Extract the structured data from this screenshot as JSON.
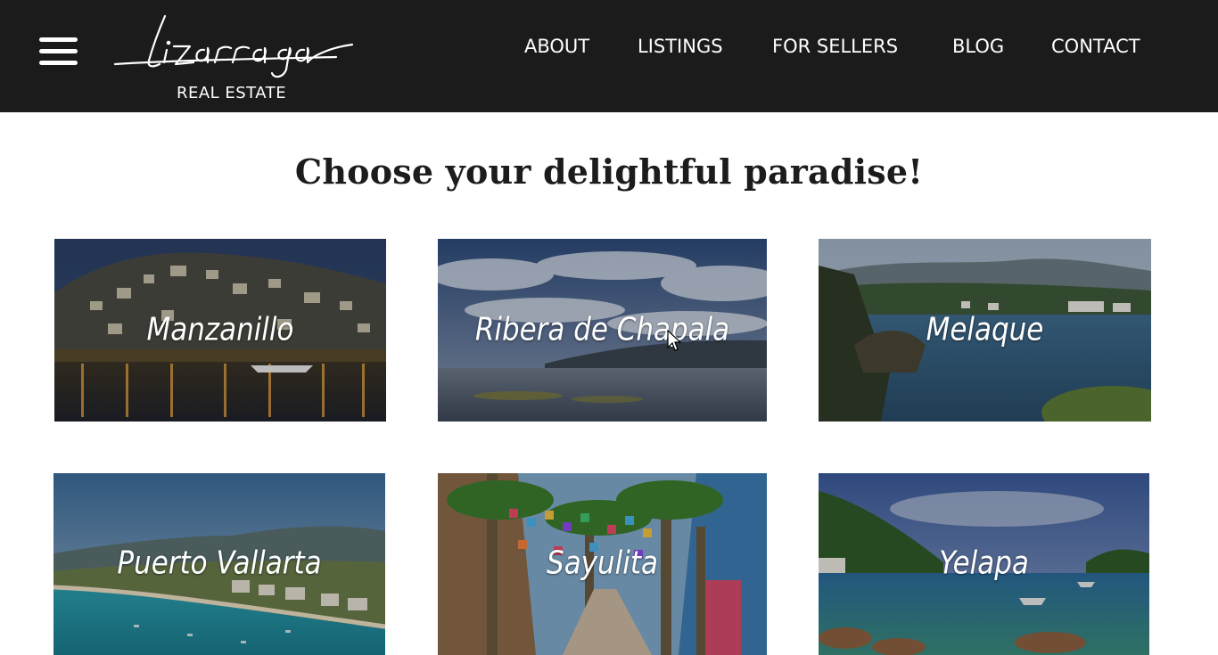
{
  "brand": {
    "script_name": "Lizarraga",
    "subtitle": "REAL ESTATE"
  },
  "nav": {
    "items": [
      {
        "label": "ABOUT"
      },
      {
        "label": "LISTINGS"
      },
      {
        "label": "FOR SELLERS"
      },
      {
        "label": "BLOG"
      },
      {
        "label": "CONTACT"
      }
    ]
  },
  "page": {
    "title": "Choose your delightful paradise!"
  },
  "destinations": [
    {
      "name": "Manzanillo"
    },
    {
      "name": "Ribera de Chapala"
    },
    {
      "name": "Melaque"
    },
    {
      "name": "Puerto Vallarta"
    },
    {
      "name": "Sayulita"
    },
    {
      "name": "Yelapa"
    }
  ],
  "colors": {
    "header_bg": "#1b1b1b",
    "header_text": "#ffffff",
    "title_text": "#1c1c1c"
  },
  "icons": {
    "menu": "hamburger-icon"
  }
}
